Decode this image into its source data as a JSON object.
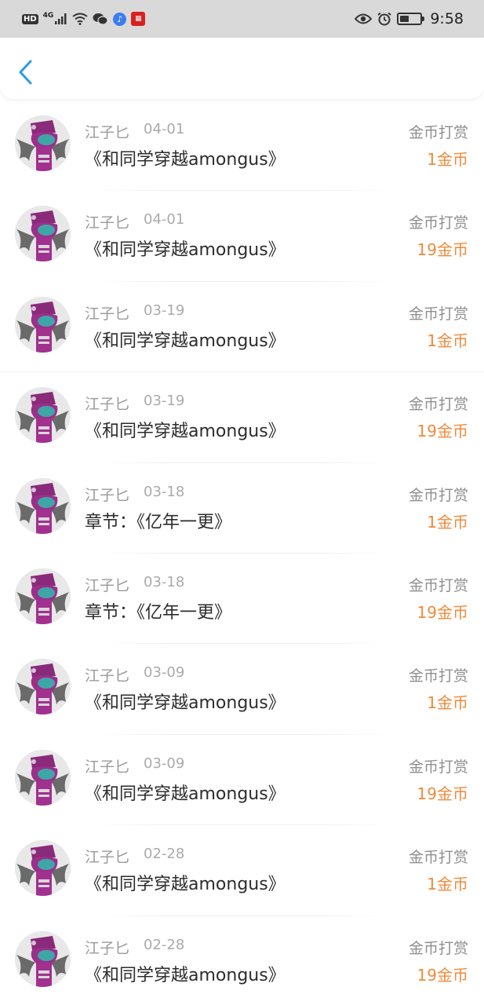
{
  "status_bar": {
    "network_badge": "HD",
    "network_type": "4G",
    "time": "9:58",
    "battery_level": 0.45,
    "icons": [
      "hd-icon",
      "signal-icon",
      "wifi-icon",
      "wechat-icon",
      "music-icon",
      "app-icon",
      "eye-icon",
      "alarm-icon",
      "battery-icon"
    ]
  },
  "header": {
    "back_icon": "chevron-left-icon"
  },
  "colors": {
    "accent_back": "#2a9be8",
    "amount": "#ef8a3a",
    "status_bar_bg": "#d9d9d9"
  },
  "records": [
    {
      "user": "江子匕",
      "date": "04-01",
      "title": "《和同学穿越amongus》",
      "type": "金币打赏",
      "amount": "1金币"
    },
    {
      "user": "江子匕",
      "date": "04-01",
      "title": "《和同学穿越amongus》",
      "type": "金币打赏",
      "amount": "19金币"
    },
    {
      "user": "江子匕",
      "date": "03-19",
      "title": "《和同学穿越amongus》",
      "type": "金币打赏",
      "amount": "1金币"
    },
    {
      "user": "江子匕",
      "date": "03-19",
      "title": "《和同学穿越amongus》",
      "type": "金币打赏",
      "amount": "19金币"
    },
    {
      "user": "江子匕",
      "date": "03-18",
      "title": "章节：《亿年一更》",
      "type": "金币打赏",
      "amount": "1金币"
    },
    {
      "user": "江子匕",
      "date": "03-18",
      "title": "章节：《亿年一更》",
      "type": "金币打赏",
      "amount": "19金币"
    },
    {
      "user": "江子匕",
      "date": "03-09",
      "title": "《和同学穿越amongus》",
      "type": "金币打赏",
      "amount": "1金币"
    },
    {
      "user": "江子匕",
      "date": "03-09",
      "title": "《和同学穿越amongus》",
      "type": "金币打赏",
      "amount": "19金币"
    },
    {
      "user": "江子匕",
      "date": "02-28",
      "title": "《和同学穿越amongus》",
      "type": "金币打赏",
      "amount": "1金币"
    },
    {
      "user": "江子匕",
      "date": "02-28",
      "title": "《和同学穿越amongus》",
      "type": "金币打赏",
      "amount": "19金币"
    }
  ]
}
